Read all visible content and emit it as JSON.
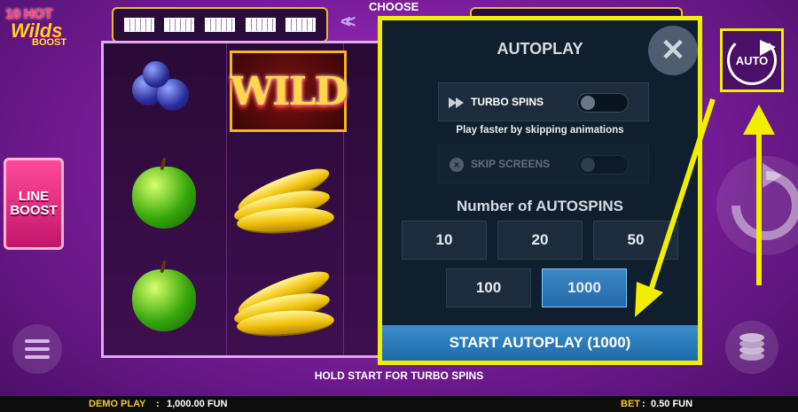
{
  "logo": {
    "line1": "10 HOT",
    "line2": "Wilds",
    "line3": "BOOST"
  },
  "header": {
    "choose_label": "CHOOSE",
    "choose_arrows": "<<"
  },
  "reels": {
    "wild_label": "WILD"
  },
  "line_boost": {
    "line1": "LINE",
    "line2": "BOOST"
  },
  "autoplay": {
    "title": "AUTOPLAY",
    "close_icon": "close-icon",
    "turbo_spins_label": "TURBO SPINS",
    "hint": "Play faster by skipping animations",
    "skip_screens_label": "SKIP SCREENS",
    "number_label": "Number of AUTOSPINS",
    "spin_options": [
      "10",
      "20",
      "50",
      "100",
      "1000"
    ],
    "selected_option": "1000",
    "start_label": "START AUTOPLAY (1000)"
  },
  "auto_button_label": "AUTO",
  "hold_hint": "HOLD START FOR TURBO SPINS",
  "bottom_bar": {
    "demo_label": "DEMO PLAY",
    "balance": "1,000.00 FUN",
    "bet_label": "BET",
    "bet_value": "0.50 FUN"
  },
  "colors": {
    "highlight": "#f2ee00",
    "accent": "#f2c81e",
    "panel": "#0f1f2e",
    "button_blue": "#2d7ec0"
  }
}
